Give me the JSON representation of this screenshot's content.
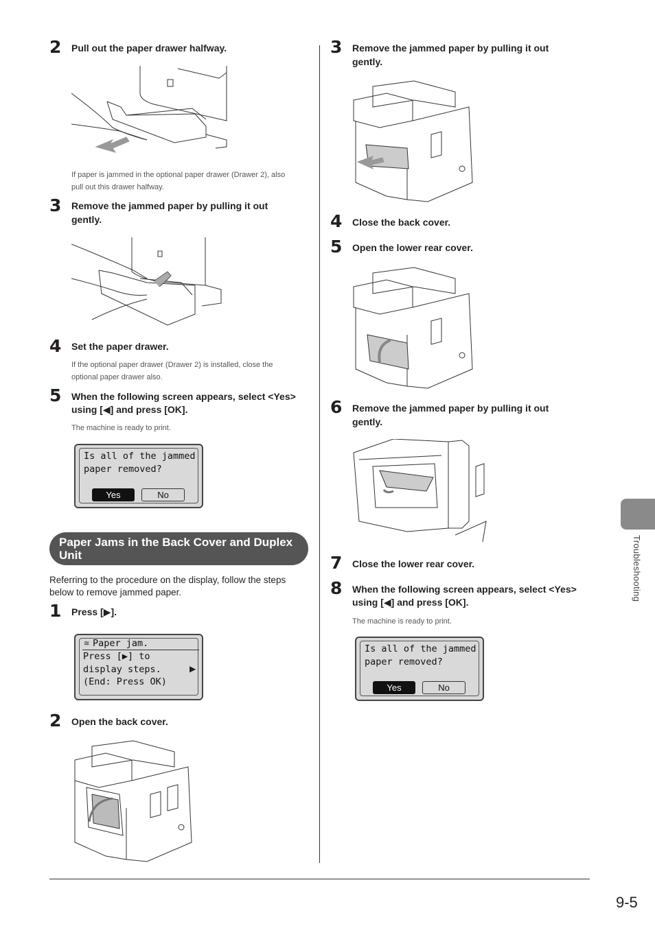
{
  "left_column": {
    "step2": {
      "num": "2",
      "title": "Pull out the paper drawer halfway.",
      "note_line1": "If paper is jammed in the optional paper drawer (Drawer 2), also",
      "note_line2": "pull out this drawer halfway."
    },
    "step3": {
      "num": "3",
      "title_line1": "Remove the jammed paper by pulling it out",
      "title_line2": "gently."
    },
    "step4": {
      "num": "4",
      "title": "Set the paper drawer.",
      "note_line1": "If the optional paper drawer (Drawer 2) is installed, close the",
      "note_line2": "optional paper drawer also."
    },
    "step5": {
      "num": "5",
      "title_line1": "When the following screen appears, select <Yes>",
      "title_line2_pre": "using [",
      "title_line2_arrow": "◀",
      "title_line2_post": "] and press [OK].",
      "note": "The machine is ready to print."
    },
    "lcd1": {
      "line1": "Is all of the jammed",
      "line2": "paper removed?",
      "yes": "Yes",
      "no": "No"
    },
    "section": {
      "title_line1": "Paper Jams in the Back Cover and Duplex",
      "title_line2": "Unit",
      "intro_line1": "Referring to the procedure on the display, follow the steps",
      "intro_line2": "below to remove jammed paper."
    },
    "sec_step1": {
      "num": "1",
      "pre": "Press [",
      "arrow": "▶",
      "post": "]."
    },
    "lcd2": {
      "icon": "paper-jam-icon",
      "line1": "Paper jam.",
      "line2": "Press [▶] to",
      "line3": "display steps.",
      "line4": "(End: Press OK)",
      "arrow": "▶"
    },
    "sec_step2": {
      "num": "2",
      "title": "Open the back cover."
    }
  },
  "right_column": {
    "step3": {
      "num": "3",
      "title_line1": "Remove the jammed paper by pulling it out",
      "title_line2": "gently."
    },
    "step4": {
      "num": "4",
      "title": "Close the back cover."
    },
    "step5": {
      "num": "5",
      "title": "Open the lower rear cover."
    },
    "step6": {
      "num": "6",
      "title_line1": "Remove the jammed paper by pulling it out",
      "title_line2": "gently."
    },
    "step7": {
      "num": "7",
      "title": "Close the lower rear cover."
    },
    "step8": {
      "num": "8",
      "title_line1": "When the following screen appears, select <Yes>",
      "title_line2_pre": "using [",
      "title_line2_arrow": "◀",
      "title_line2_post": "] and press [OK].",
      "note": "The machine is ready to print."
    },
    "lcd3": {
      "line1": "Is all of the jammed",
      "line2": "paper removed?",
      "yes": "Yes",
      "no": "No"
    }
  },
  "sidebar": {
    "label": "Troubleshooting"
  },
  "footer": {
    "page_number": "9-5"
  }
}
